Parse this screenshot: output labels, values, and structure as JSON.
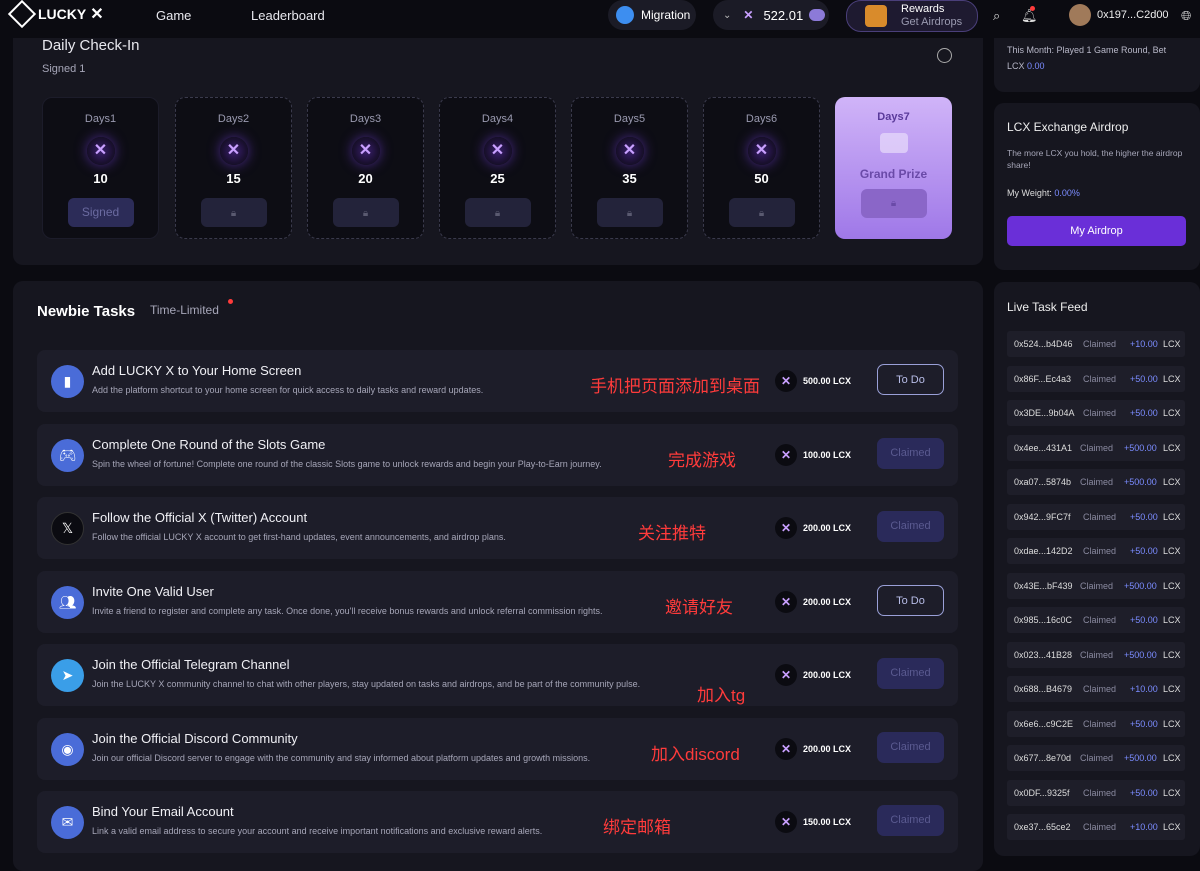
{
  "header": {
    "logo_text": "LUCKY",
    "nav": [
      "Game",
      "Leaderboard"
    ],
    "migration_label": "Migration",
    "balance": "522.01",
    "rewards_title": "Rewards",
    "rewards_sub": "Get Airdrops",
    "address": "0x197...C2d00"
  },
  "checkin": {
    "title": "Daily Check-In",
    "subtitle": "Signed 1",
    "days": [
      {
        "label": "Days1",
        "amount": "10",
        "button": "Signed"
      },
      {
        "label": "Days2",
        "amount": "15",
        "button": ""
      },
      {
        "label": "Days3",
        "amount": "20",
        "button": ""
      },
      {
        "label": "Days4",
        "amount": "25",
        "button": ""
      },
      {
        "label": "Days5",
        "amount": "35",
        "button": ""
      },
      {
        "label": "Days6",
        "amount": "50",
        "button": ""
      }
    ],
    "grand": {
      "label": "Days7",
      "text": "Grand Prize"
    }
  },
  "sidebar": {
    "month_text": "This Month: Played 1 Game Round, Bet",
    "month_lcx_prefix": "LCX",
    "month_lcx_value": "0.00",
    "airdrop_title": "LCX Exchange Airdrop",
    "airdrop_desc": "The more LCX you hold, the higher the airdrop share!",
    "weight_label": "My Weight:",
    "weight_value": "0.00%",
    "airdrop_button": "My Airdrop",
    "feed_title": "Live Task Feed",
    "feed": [
      {
        "addr": "0x524...b4D46",
        "status": "Claimed",
        "amount": "+10.00",
        "unit": "LCX"
      },
      {
        "addr": "0x86F...Ec4a3",
        "status": "Claimed",
        "amount": "+50.00",
        "unit": "LCX"
      },
      {
        "addr": "0x3DE...9b04A",
        "status": "Claimed",
        "amount": "+50.00",
        "unit": "LCX"
      },
      {
        "addr": "0x4ee...431A1",
        "status": "Claimed",
        "amount": "+500.00",
        "unit": "LCX"
      },
      {
        "addr": "0xa07...5874b",
        "status": "Claimed",
        "amount": "+500.00",
        "unit": "LCX"
      },
      {
        "addr": "0x942...9FC7f",
        "status": "Claimed",
        "amount": "+50.00",
        "unit": "LCX"
      },
      {
        "addr": "0xdae...142D2",
        "status": "Claimed",
        "amount": "+50.00",
        "unit": "LCX"
      },
      {
        "addr": "0x43E...bF439",
        "status": "Claimed",
        "amount": "+500.00",
        "unit": "LCX"
      },
      {
        "addr": "0x985...16c0C",
        "status": "Claimed",
        "amount": "+50.00",
        "unit": "LCX"
      },
      {
        "addr": "0x023...41B28",
        "status": "Claimed",
        "amount": "+500.00",
        "unit": "LCX"
      },
      {
        "addr": "0x688...B4679",
        "status": "Claimed",
        "amount": "+10.00",
        "unit": "LCX"
      },
      {
        "addr": "0x6e6...c9C2E",
        "status": "Claimed",
        "amount": "+50.00",
        "unit": "LCX"
      },
      {
        "addr": "0x677...8e70d",
        "status": "Claimed",
        "amount": "+500.00",
        "unit": "LCX"
      },
      {
        "addr": "0x0DF...9325f",
        "status": "Claimed",
        "amount": "+50.00",
        "unit": "LCX"
      },
      {
        "addr": "0xe37...65ce2",
        "status": "Claimed",
        "amount": "+10.00",
        "unit": "LCX"
      }
    ]
  },
  "tasks": {
    "tab_active": "Newbie Tasks",
    "tab_other": "Time-Limited",
    "items": [
      {
        "title": "Add LUCKY X to Your Home Screen",
        "desc": "Add the platform shortcut to your home screen for quick access to daily tasks and reward updates.",
        "reward": "500.00 LCX",
        "button": "To Do",
        "note": "手机把页面添加到桌面",
        "icon": "phone-icon"
      },
      {
        "title": "Complete One Round of the Slots Game",
        "desc": "Spin the wheel of fortune! Complete one round of the classic Slots game to unlock rewards and begin your Play-to-Earn journey.",
        "reward": "100.00 LCX",
        "button": "Claimed",
        "note": "完成游戏",
        "icon": "gamepad-icon"
      },
      {
        "title": "Follow the Official X (Twitter) Account",
        "desc": "Follow the official LUCKY X account to get first-hand updates, event announcements, and airdrop plans.",
        "reward": "200.00 LCX",
        "button": "Claimed",
        "note": "关注推特",
        "icon": "x-logo-icon"
      },
      {
        "title": "Invite One Valid User",
        "desc": "Invite a friend to register and complete any task. Once done, you'll receive bonus rewards and unlock referral commission rights.",
        "reward": "200.00 LCX",
        "button": "To Do",
        "note": "邀请好友",
        "icon": "invite-icon"
      },
      {
        "title": "Join the Official Telegram Channel",
        "desc": "Join the LUCKY X community channel to chat with other players, stay updated on tasks and airdrops, and be part of the community pulse.",
        "reward": "200.00 LCX",
        "button": "Claimed",
        "note": "加入tg",
        "icon": "telegram-icon"
      },
      {
        "title": "Join the Official Discord Community",
        "desc": "Join our official Discord server to engage with the community and stay informed about platform updates and growth missions.",
        "reward": "200.00 LCX",
        "button": "Claimed",
        "note": "加入discord",
        "icon": "discord-icon"
      },
      {
        "title": "Bind Your Email Account",
        "desc": "Link a valid email address to secure your account and receive important notifications and exclusive reward alerts.",
        "reward": "150.00 LCX",
        "button": "Claimed",
        "note": "绑定邮箱",
        "icon": "email-icon"
      }
    ]
  },
  "colors": {
    "accent": "#6a2fd8",
    "claimed_bg": "#2a2a5a",
    "note_red": "#ff3b3b",
    "feed_green": "#44d07a",
    "feed_blue": "#7b8cff"
  }
}
